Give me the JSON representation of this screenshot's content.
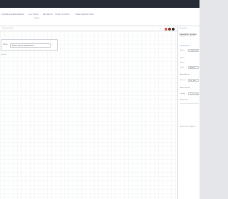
{
  "nav": {
    "tabs": [
      "SCHEDULES",
      "VARIABLES",
      "ALL RUNS",
      "SECRETS",
      "STAR COUNTS",
      "TIME OPERATIONS"
    ],
    "sub": "RULES"
  },
  "canvas": {
    "toolbar_label": "Operations Flow",
    "node_label": "Action",
    "node_select_value": "Please select a Operation Act...",
    "canvas_label": "Action 1",
    "status_colors": [
      "#e05a47",
      "#7a3b2e",
      "#2f2f2f"
    ]
  },
  "side": {
    "tab": "Properties",
    "title": "Operation System",
    "subtitle": "Configure an operation",
    "section_label": "Operations list",
    "rows": [
      {
        "label": "Action",
        "value": "1_NEW_STEP"
      },
      {
        "label": "Label",
        "value": ""
      },
      {
        "label": "Event",
        "value": "Start Action"
      },
      {
        "label": "Input",
        "value": "PARENT"
      },
      {
        "label": "Action Name",
        "value": ""
      },
      {
        "label": "Process",
        "value": "Start Step"
      },
      {
        "label": "Action Version",
        "value": ""
      },
      {
        "label": "Output",
        "value": "CUSTOM VALUE"
      },
      {
        "label": "Expression",
        "value": ""
      },
      {
        "label": "Expression conditions",
        "value": ""
      }
    ]
  }
}
